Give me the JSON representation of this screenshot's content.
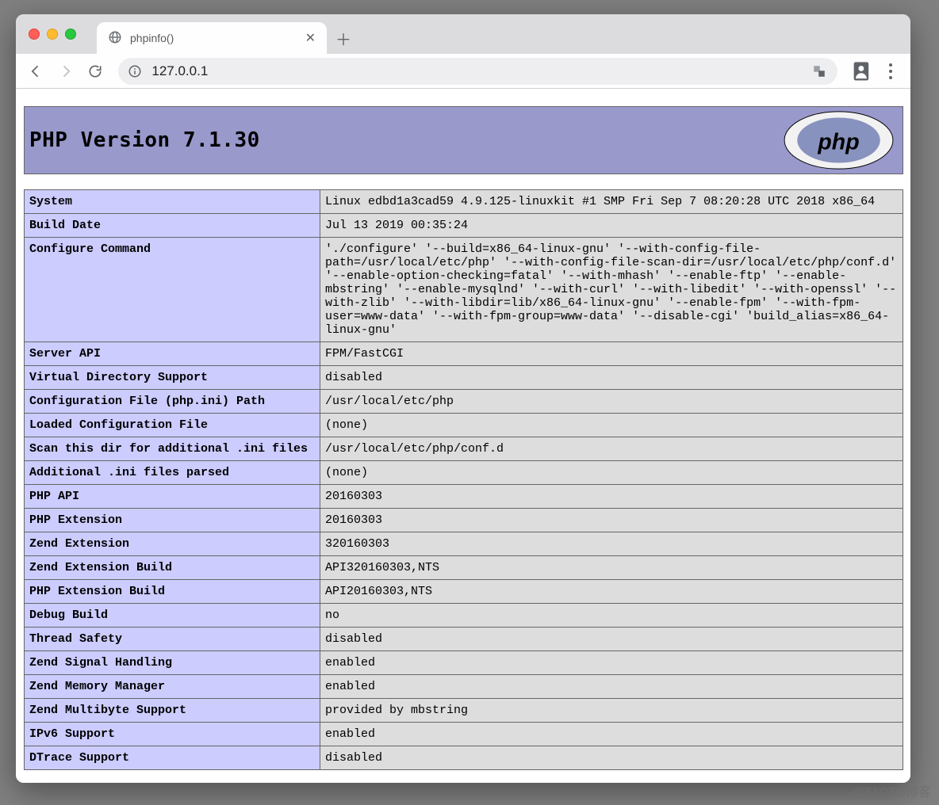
{
  "browser": {
    "tab_title": "phpinfo()",
    "url": "127.0.0.1",
    "translate_label": "Translate",
    "profile_label": "Profile",
    "menu_label": "Customize and control"
  },
  "php": {
    "version_heading": "PHP Version 7.1.30",
    "rows": [
      {
        "k": "System",
        "v": "Linux edbd1a3cad59 4.9.125-linuxkit #1 SMP Fri Sep 7 08:20:28 UTC 2018 x86_64"
      },
      {
        "k": "Build Date",
        "v": "Jul 13 2019 00:35:24"
      },
      {
        "k": "Configure Command",
        "v": "'./configure' '--build=x86_64-linux-gnu' '--with-config-file-path=/usr/local/etc/php' '--with-config-file-scan-dir=/usr/local/etc/php/conf.d' '--enable-option-checking=fatal' '--with-mhash' '--enable-ftp' '--enable-mbstring' '--enable-mysqlnd' '--with-curl' '--with-libedit' '--with-openssl' '--with-zlib' '--with-libdir=lib/x86_64-linux-gnu' '--enable-fpm' '--with-fpm-user=www-data' '--with-fpm-group=www-data' '--disable-cgi' 'build_alias=x86_64-linux-gnu'"
      },
      {
        "k": "Server API",
        "v": "FPM/FastCGI"
      },
      {
        "k": "Virtual Directory Support",
        "v": "disabled"
      },
      {
        "k": "Configuration File (php.ini) Path",
        "v": "/usr/local/etc/php"
      },
      {
        "k": "Loaded Configuration File",
        "v": "(none)"
      },
      {
        "k": "Scan this dir for additional .ini files",
        "v": "/usr/local/etc/php/conf.d"
      },
      {
        "k": "Additional .ini files parsed",
        "v": "(none)"
      },
      {
        "k": "PHP API",
        "v": "20160303"
      },
      {
        "k": "PHP Extension",
        "v": "20160303"
      },
      {
        "k": "Zend Extension",
        "v": "320160303"
      },
      {
        "k": "Zend Extension Build",
        "v": "API320160303,NTS"
      },
      {
        "k": "PHP Extension Build",
        "v": "API20160303,NTS"
      },
      {
        "k": "Debug Build",
        "v": "no"
      },
      {
        "k": "Thread Safety",
        "v": "disabled"
      },
      {
        "k": "Zend Signal Handling",
        "v": "enabled"
      },
      {
        "k": "Zend Memory Manager",
        "v": "enabled"
      },
      {
        "k": "Zend Multibyte Support",
        "v": "provided by mbstring"
      },
      {
        "k": "IPv6 Support",
        "v": "enabled"
      },
      {
        "k": "DTrace Support",
        "v": "disabled"
      }
    ]
  },
  "watermark": "@51CTO博客"
}
